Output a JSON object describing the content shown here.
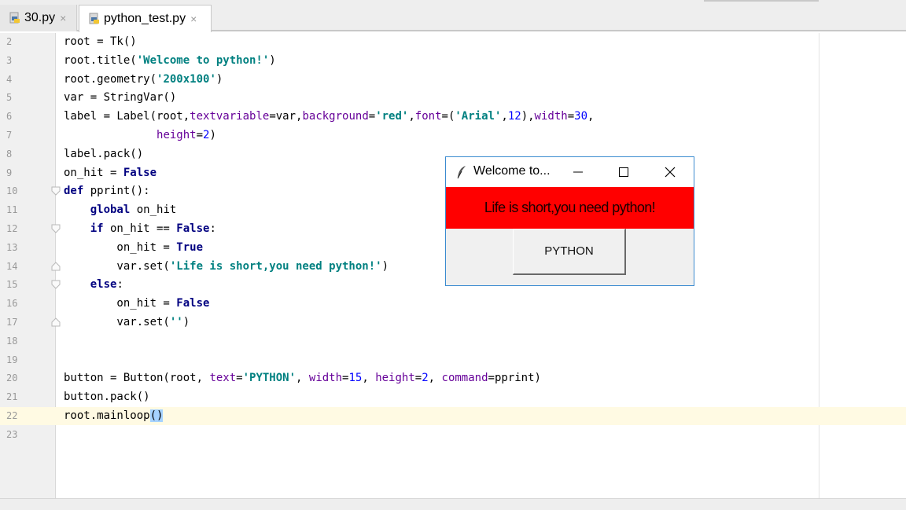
{
  "tabs": [
    {
      "label": "30.py",
      "close": "×"
    },
    {
      "label": "python_test.py",
      "close": "×"
    }
  ],
  "editor": {
    "lines": [
      {
        "n": "2",
        "tokens": [
          [
            "t",
            "root = Tk()"
          ]
        ]
      },
      {
        "n": "3",
        "tokens": [
          [
            "t",
            "root.title("
          ],
          [
            "s",
            "'Welcome to python!'"
          ],
          [
            "t",
            ")"
          ]
        ]
      },
      {
        "n": "4",
        "tokens": [
          [
            "t",
            "root.geometry("
          ],
          [
            "s",
            "'200x100'"
          ],
          [
            "t",
            ")"
          ]
        ]
      },
      {
        "n": "5",
        "tokens": [
          [
            "t",
            "var = StringVar()"
          ]
        ]
      },
      {
        "n": "6",
        "tokens": [
          [
            "t",
            "label = Label(root,"
          ],
          [
            "p",
            "textvariable"
          ],
          [
            "t",
            "=var,"
          ],
          [
            "p",
            "background"
          ],
          [
            "t",
            "="
          ],
          [
            "s",
            "'red'"
          ],
          [
            "t",
            ","
          ],
          [
            "p",
            "font"
          ],
          [
            "t",
            "=("
          ],
          [
            "s",
            "'Arial'"
          ],
          [
            "t",
            ","
          ],
          [
            "n",
            "12"
          ],
          [
            "t",
            "),"
          ],
          [
            "p",
            "width"
          ],
          [
            "t",
            "="
          ],
          [
            "n",
            "30"
          ],
          [
            "t",
            ","
          ]
        ]
      },
      {
        "n": "7",
        "tokens": [
          [
            "t",
            "              "
          ],
          [
            "p",
            "height"
          ],
          [
            "t",
            "="
          ],
          [
            "n",
            "2"
          ],
          [
            "t",
            ")"
          ]
        ]
      },
      {
        "n": "8",
        "tokens": [
          [
            "t",
            "label.pack()"
          ]
        ]
      },
      {
        "n": "9",
        "tokens": [
          [
            "t",
            "on_hit = "
          ],
          [
            "k",
            "False"
          ]
        ]
      },
      {
        "n": "10",
        "tokens": [
          [
            "k",
            "def"
          ],
          [
            "t",
            " pprint():"
          ]
        ]
      },
      {
        "n": "11",
        "tokens": [
          [
            "t",
            "    "
          ],
          [
            "k",
            "global"
          ],
          [
            "t",
            " on_hit"
          ]
        ]
      },
      {
        "n": "12",
        "tokens": [
          [
            "t",
            "    "
          ],
          [
            "k",
            "if"
          ],
          [
            "t",
            " on_hit == "
          ],
          [
            "k",
            "False"
          ],
          [
            "t",
            ":"
          ]
        ]
      },
      {
        "n": "13",
        "tokens": [
          [
            "t",
            "        on_hit = "
          ],
          [
            "k",
            "True"
          ]
        ]
      },
      {
        "n": "14",
        "tokens": [
          [
            "t",
            "        var.set("
          ],
          [
            "s",
            "'Life is short,you need python!'"
          ],
          [
            "t",
            ")"
          ]
        ]
      },
      {
        "n": "15",
        "tokens": [
          [
            "t",
            "    "
          ],
          [
            "k",
            "else"
          ],
          [
            "t",
            ":"
          ]
        ]
      },
      {
        "n": "16",
        "tokens": [
          [
            "t",
            "        on_hit = "
          ],
          [
            "k",
            "False"
          ]
        ]
      },
      {
        "n": "17",
        "tokens": [
          [
            "t",
            "        var.set("
          ],
          [
            "s",
            "''"
          ],
          [
            "t",
            ")"
          ]
        ]
      },
      {
        "n": "18",
        "tokens": []
      },
      {
        "n": "19",
        "tokens": []
      },
      {
        "n": "20",
        "tokens": [
          [
            "t",
            "button = Button(root, "
          ],
          [
            "p",
            "text"
          ],
          [
            "t",
            "="
          ],
          [
            "s",
            "'PYTHON'"
          ],
          [
            "t",
            ", "
          ],
          [
            "p",
            "width"
          ],
          [
            "t",
            "="
          ],
          [
            "n",
            "15"
          ],
          [
            "t",
            ", "
          ],
          [
            "p",
            "height"
          ],
          [
            "t",
            "="
          ],
          [
            "n",
            "2"
          ],
          [
            "t",
            ", "
          ],
          [
            "p",
            "command"
          ],
          [
            "t",
            "=pprint)"
          ]
        ]
      },
      {
        "n": "21",
        "tokens": [
          [
            "t",
            "button.pack()"
          ]
        ]
      },
      {
        "n": "22",
        "tokens": [
          [
            "t",
            "root.mainloop"
          ],
          [
            "x",
            "()"
          ]
        ],
        "current": true
      },
      {
        "n": "23",
        "tokens": []
      }
    ],
    "colors": {
      "keyword": "#000080",
      "string": "#008080",
      "param": "#660099",
      "number": "#0000ff",
      "current_line": "#fffae3"
    }
  },
  "tk_window": {
    "title": "Welcome to...",
    "minimize_label": "minimize-icon",
    "label_text": "Life is short,you need python!",
    "label_bg": "#ff0000",
    "button_text": "PYTHON"
  }
}
